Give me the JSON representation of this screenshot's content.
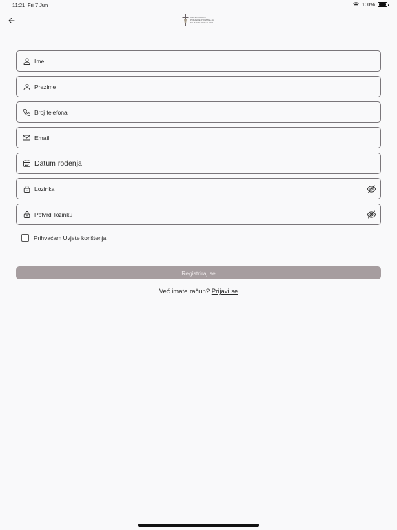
{
  "status_bar": {
    "time": "11:21",
    "date": "Fri 7 Jun",
    "battery": "100%",
    "battery_level": 1.0
  },
  "header": {
    "back_icon": "arrow-left-icon",
    "logo_lines": [
      "CRKVA KRISTA",
      "POBJEDE PRIJATELJA",
      "SV. FRANJO SV. LUKA"
    ]
  },
  "form": {
    "first_name": {
      "placeholder": "Ime",
      "icon": "person-icon"
    },
    "last_name": {
      "placeholder": "Prezime",
      "icon": "person-icon"
    },
    "phone": {
      "placeholder": "Broj telefona",
      "icon": "phone-icon"
    },
    "email": {
      "placeholder": "Email",
      "icon": "mail-icon"
    },
    "birth_date": {
      "placeholder": "Datum rođenja",
      "icon": "calendar-icon"
    },
    "password": {
      "placeholder": "Lozinka",
      "icon": "lock-icon",
      "toggle_icon": "eye-off-icon"
    },
    "confirm_password": {
      "placeholder": "Potvrdi lozinku",
      "icon": "lock-icon",
      "toggle_icon": "eye-off-icon"
    },
    "terms": {
      "prefix": "Prihvaćam",
      "link": "Uvjete korištenja",
      "checked": false
    },
    "register_label": "Registriraj se",
    "login_prompt": "Već imate račun?",
    "login_link": "Prijavi se"
  },
  "colors": {
    "background": "#f9f9fa",
    "field_border": "#7a767a",
    "button_bg": "#a69d9f",
    "button_text": "#ece7e8"
  }
}
